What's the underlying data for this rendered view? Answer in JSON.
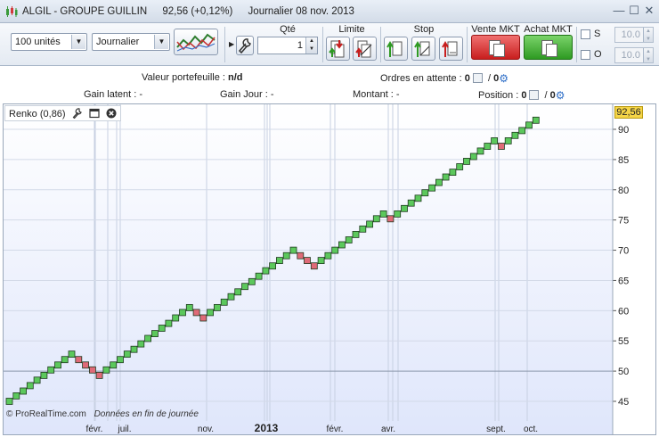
{
  "window": {
    "symbol": "ALGIL - GROUPE GUILLIN",
    "price": "92,56 (+0,12%)",
    "period": "Journalier  08 nov. 2013",
    "controls": [
      "—",
      "☐",
      "✕"
    ]
  },
  "toolbar": {
    "quantity_select": "100 unités",
    "period_select": "Journalier",
    "qty_label": "Qté",
    "qty_value": "1",
    "limit_label": "Limite",
    "stop_label": "Stop",
    "sell_label": "Vente MKT",
    "buy_label": "Achat MKT",
    "s_label": "S",
    "o_label": "O",
    "s_value": "10.0",
    "o_value": "10.0"
  },
  "info": {
    "portfolio_label": "Valeur portefeuille : ",
    "portfolio_value": "n/d",
    "orders_label": "Ordres en attente : ",
    "orders_a": "0",
    "orders_sep": " / ",
    "orders_b": "0",
    "gain_latent": "Gain latent : -",
    "gain_jour": "Gain Jour : -",
    "montant": "Montant : -",
    "position_label": "Position : ",
    "position_a": "0",
    "position_sep": " / ",
    "position_b": "0"
  },
  "chart_data": {
    "type": "renko",
    "indicator": "Renko (0,86)",
    "last_price": "92,56",
    "ylim": [
      43,
      93
    ],
    "y_ticks": [
      45,
      50,
      55,
      60,
      65,
      70,
      75,
      80,
      85,
      90
    ],
    "x_labels": [
      "févr.",
      "juil.",
      "nov.",
      "2013",
      "févr.",
      "avr.",
      "sept.",
      "oct."
    ],
    "watermark": "© ProRealTime.com",
    "watermark_note": "Données en fin de journée",
    "colors": {
      "up": "#5cc85c",
      "down": "#e06a78",
      "bg_top": "#ffffff",
      "bg_bottom": "#dfe6fb"
    },
    "bricks": [
      {
        "y": 45.0,
        "d": "up"
      },
      {
        "y": 45.9,
        "d": "up"
      },
      {
        "y": 46.7,
        "d": "up"
      },
      {
        "y": 47.6,
        "d": "up"
      },
      {
        "y": 48.5,
        "d": "up"
      },
      {
        "y": 49.3,
        "d": "up"
      },
      {
        "y": 50.2,
        "d": "up"
      },
      {
        "y": 51.0,
        "d": "up"
      },
      {
        "y": 51.9,
        "d": "up"
      },
      {
        "y": 52.8,
        "d": "up"
      },
      {
        "y": 51.9,
        "d": "down"
      },
      {
        "y": 51.0,
        "d": "down"
      },
      {
        "y": 50.2,
        "d": "down"
      },
      {
        "y": 49.3,
        "d": "down"
      },
      {
        "y": 50.2,
        "d": "up"
      },
      {
        "y": 51.0,
        "d": "up"
      },
      {
        "y": 51.9,
        "d": "up"
      },
      {
        "y": 52.8,
        "d": "up"
      },
      {
        "y": 53.6,
        "d": "up"
      },
      {
        "y": 54.5,
        "d": "up"
      },
      {
        "y": 55.4,
        "d": "up"
      },
      {
        "y": 56.2,
        "d": "up"
      },
      {
        "y": 57.1,
        "d": "up"
      },
      {
        "y": 57.9,
        "d": "up"
      },
      {
        "y": 58.8,
        "d": "up"
      },
      {
        "y": 59.7,
        "d": "up"
      },
      {
        "y": 60.5,
        "d": "up"
      },
      {
        "y": 59.7,
        "d": "down"
      },
      {
        "y": 58.8,
        "d": "down"
      },
      {
        "y": 59.7,
        "d": "up"
      },
      {
        "y": 60.5,
        "d": "up"
      },
      {
        "y": 61.4,
        "d": "up"
      },
      {
        "y": 62.3,
        "d": "up"
      },
      {
        "y": 63.1,
        "d": "up"
      },
      {
        "y": 64.0,
        "d": "up"
      },
      {
        "y": 64.8,
        "d": "up"
      },
      {
        "y": 65.7,
        "d": "up"
      },
      {
        "y": 66.6,
        "d": "up"
      },
      {
        "y": 67.4,
        "d": "up"
      },
      {
        "y": 68.3,
        "d": "up"
      },
      {
        "y": 69.1,
        "d": "up"
      },
      {
        "y": 70.0,
        "d": "up"
      },
      {
        "y": 69.1,
        "d": "down"
      },
      {
        "y": 68.3,
        "d": "down"
      },
      {
        "y": 67.4,
        "d": "down"
      },
      {
        "y": 68.3,
        "d": "up"
      },
      {
        "y": 69.1,
        "d": "up"
      },
      {
        "y": 70.0,
        "d": "up"
      },
      {
        "y": 70.9,
        "d": "up"
      },
      {
        "y": 71.7,
        "d": "up"
      },
      {
        "y": 72.6,
        "d": "up"
      },
      {
        "y": 73.5,
        "d": "up"
      },
      {
        "y": 74.3,
        "d": "up"
      },
      {
        "y": 75.2,
        "d": "up"
      },
      {
        "y": 76.0,
        "d": "up"
      },
      {
        "y": 75.2,
        "d": "down"
      },
      {
        "y": 76.0,
        "d": "up"
      },
      {
        "y": 76.9,
        "d": "up"
      },
      {
        "y": 77.8,
        "d": "up"
      },
      {
        "y": 78.6,
        "d": "up"
      },
      {
        "y": 79.5,
        "d": "up"
      },
      {
        "y": 80.3,
        "d": "up"
      },
      {
        "y": 81.2,
        "d": "up"
      },
      {
        "y": 82.1,
        "d": "up"
      },
      {
        "y": 82.9,
        "d": "up"
      },
      {
        "y": 83.8,
        "d": "up"
      },
      {
        "y": 84.7,
        "d": "up"
      },
      {
        "y": 85.5,
        "d": "up"
      },
      {
        "y": 86.4,
        "d": "up"
      },
      {
        "y": 87.2,
        "d": "up"
      },
      {
        "y": 88.1,
        "d": "up"
      },
      {
        "y": 87.2,
        "d": "down"
      },
      {
        "y": 88.1,
        "d": "up"
      },
      {
        "y": 89.0,
        "d": "up"
      },
      {
        "y": 89.8,
        "d": "up"
      },
      {
        "y": 90.7,
        "d": "up"
      },
      {
        "y": 91.5,
        "d": "up"
      }
    ]
  }
}
